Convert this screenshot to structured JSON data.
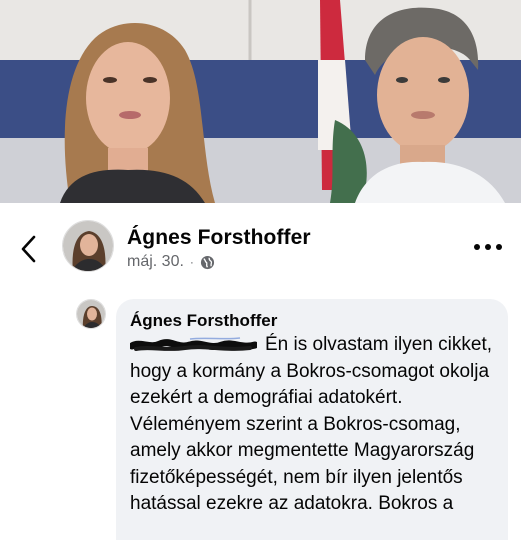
{
  "post": {
    "author": "Ágnes Forsthoffer",
    "date": "máj. 30.",
    "separator": "·",
    "audience_icon": "globe-icon",
    "back_icon": "chevron-left-icon",
    "more_icon": "more-horizontal-icon"
  },
  "comment": {
    "author": "Ágnes Forsthoffer",
    "text": "Én is olvastam ilyen cikket, hogy a kormány a Bokros-csomagot okolja ezekért a demográfiai adatokért. Véleményem szerint a Bokros-csomag, amely akkor megmentette Magyarország fizetőképességét, nem bír ilyen jelentős hatással ezekre az adatokra. Bokros a"
  },
  "colors": {
    "meta_text": "#65676b",
    "bubble_bg": "#f0f2f5",
    "text": "#050505",
    "flag_red": "#cd2a3e",
    "flag_green": "#436f4d"
  }
}
